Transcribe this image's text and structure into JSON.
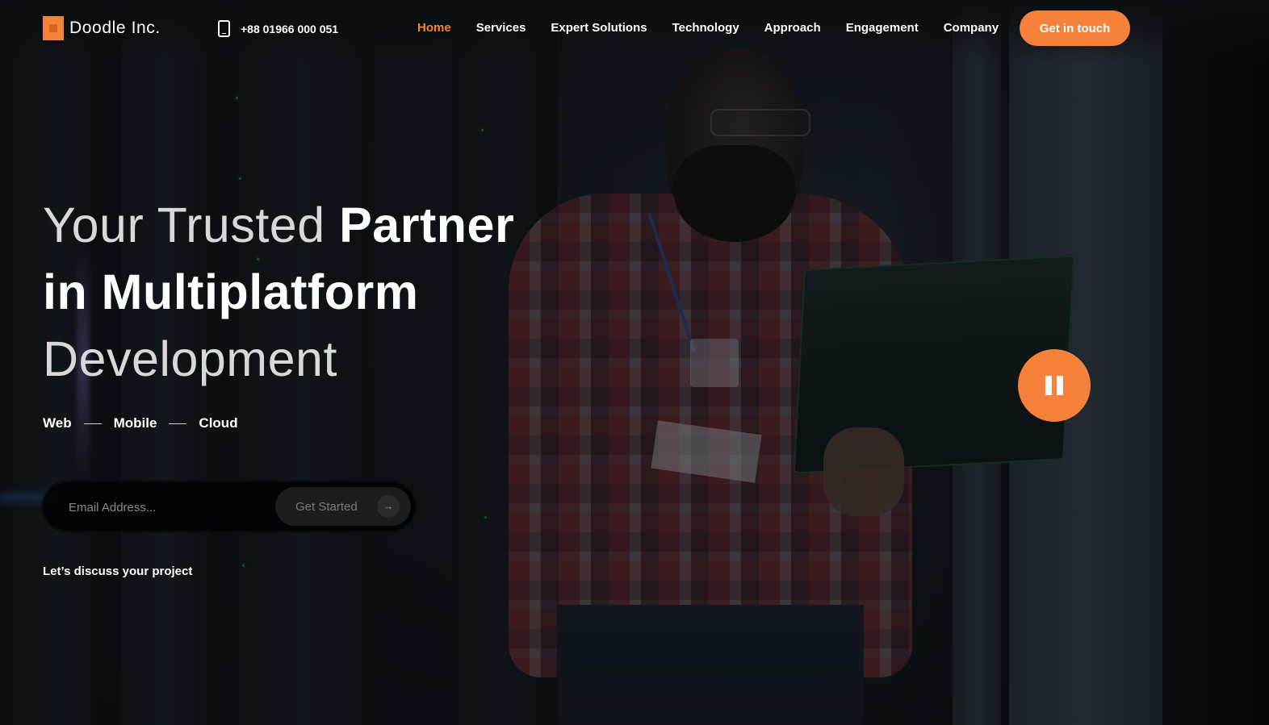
{
  "brand": {
    "name": "Doodle Inc.",
    "accent": "#f5813a"
  },
  "header": {
    "phone": "+88 01966 000 051",
    "nav": [
      {
        "label": "Home",
        "active": true
      },
      {
        "label": "Services"
      },
      {
        "label": "Expert Solutions"
      },
      {
        "label": "Technology"
      },
      {
        "label": "Approach"
      },
      {
        "label": "Engagement"
      },
      {
        "label": "Company"
      }
    ],
    "cta_label": "Get in touch"
  },
  "hero": {
    "title_light_1": "Your Trusted ",
    "title_bold_1": "Partner",
    "title_bold_2": "in Multiplatform",
    "title_light_2": "Development",
    "platforms": [
      "Web",
      "Mobile",
      "Cloud"
    ],
    "email_placeholder": "Email Address...",
    "submit_label": "Get Started",
    "submit_icon": "arrow-right-icon",
    "discuss_link": "Let’s discuss your project"
  },
  "media": {
    "control_icon": "pause-icon",
    "state": "playing"
  }
}
